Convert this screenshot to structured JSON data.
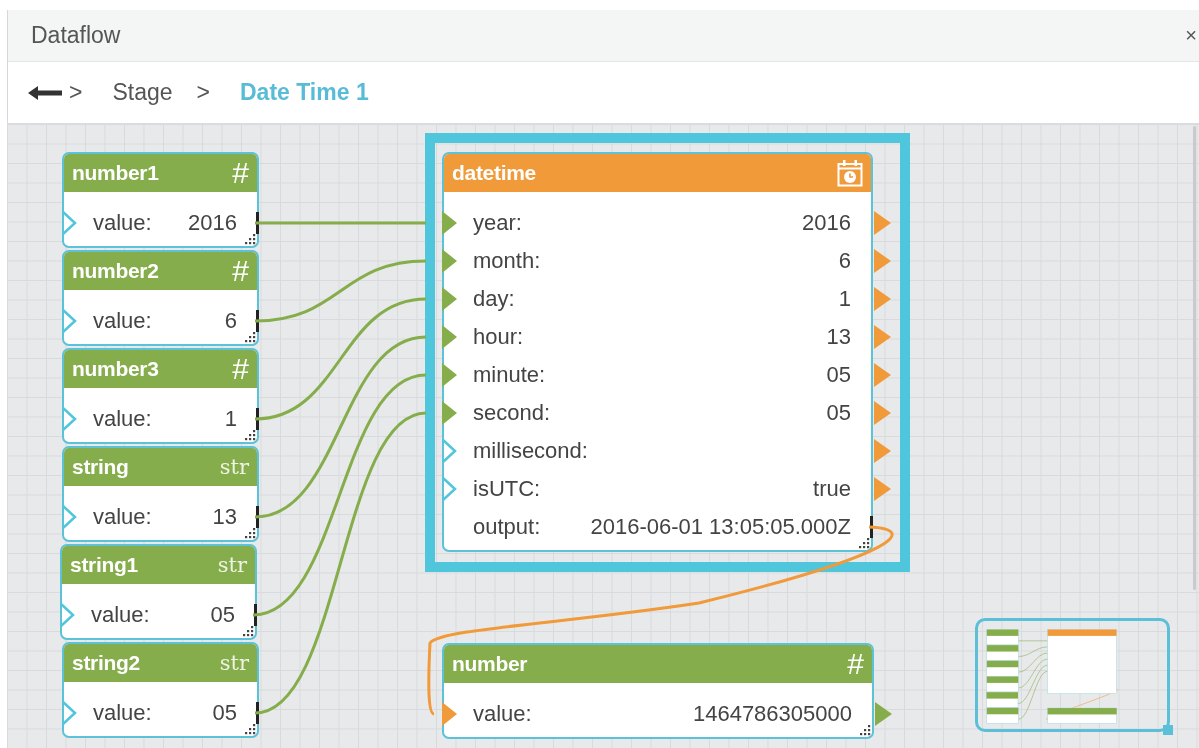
{
  "panel": {
    "title": "Dataflow",
    "close": "×"
  },
  "breadcrumb": [
    {
      "kind": "separator",
      "text": ">"
    },
    {
      "kind": "crumb",
      "text": "Stage",
      "selected": false
    },
    {
      "kind": "separator",
      "text": ">"
    },
    {
      "kind": "crumb",
      "text": "Date Time 1",
      "selected": true
    }
  ],
  "nodes": [
    {
      "kind": "number",
      "title": "number1",
      "badge": "#",
      "color": "#86ad4b",
      "selected": false,
      "ports": [
        {
          "kind": "value",
          "label": "value:",
          "value": "2016",
          "linked": false
        }
      ]
    },
    {
      "kind": "number",
      "title": "number2",
      "badge": "#",
      "color": "#86ad4b",
      "selected": false,
      "ports": [
        {
          "kind": "value",
          "label": "value:",
          "value": "6",
          "linked": false
        }
      ]
    },
    {
      "kind": "number",
      "title": "number3",
      "badge": "#",
      "color": "#86ad4b",
      "selected": false,
      "ports": [
        {
          "kind": "value",
          "label": "value:",
          "value": "1",
          "linked": false
        }
      ]
    },
    {
      "kind": "string",
      "title": "string",
      "badge": "str",
      "color": "#86ad4b",
      "selected": false,
      "ports": [
        {
          "kind": "value",
          "label": "value:",
          "value": "13",
          "linked": false
        }
      ]
    },
    {
      "kind": "string",
      "title": "string1",
      "badge": "str",
      "color": "#86ad4b",
      "selected": false,
      "ports": [
        {
          "kind": "value",
          "label": "value:",
          "value": "05",
          "linked": false
        }
      ]
    },
    {
      "kind": "string",
      "title": "string2",
      "badge": "str",
      "color": "#86ad4b",
      "selected": false,
      "ports": [
        {
          "kind": "value",
          "label": "value:",
          "value": "05",
          "linked": false
        }
      ]
    },
    {
      "kind": "datetime",
      "title": "datetime",
      "color": "#f09a3a",
      "selected": true,
      "ports": [
        {
          "kind": "input",
          "label": "year:",
          "value": "2016",
          "linked": true
        },
        {
          "kind": "input",
          "label": "month:",
          "value": "6",
          "linked": true
        },
        {
          "kind": "input",
          "label": "day:",
          "value": "1",
          "linked": true
        },
        {
          "kind": "input",
          "label": "hour:",
          "value": "13",
          "linked": true
        },
        {
          "kind": "input",
          "label": "minute:",
          "value": "05",
          "linked": true
        },
        {
          "kind": "input",
          "label": "second:",
          "value": "05",
          "linked": true
        },
        {
          "kind": "input",
          "label": "millisecond:",
          "linked": false
        },
        {
          "kind": "input",
          "label": "isUTC:",
          "value": "true",
          "linked": false
        },
        {
          "kind": "output",
          "label": "output:",
          "value": "2016-06-01 13:05:05.000Z"
        }
      ]
    },
    {
      "kind": "number",
      "title": "number",
      "badge": "#",
      "color": "#86ad4b",
      "selected": false,
      "ports": [
        {
          "kind": "input",
          "label": "value:",
          "value": "1464786305000",
          "linked": true
        }
      ]
    }
  ]
}
